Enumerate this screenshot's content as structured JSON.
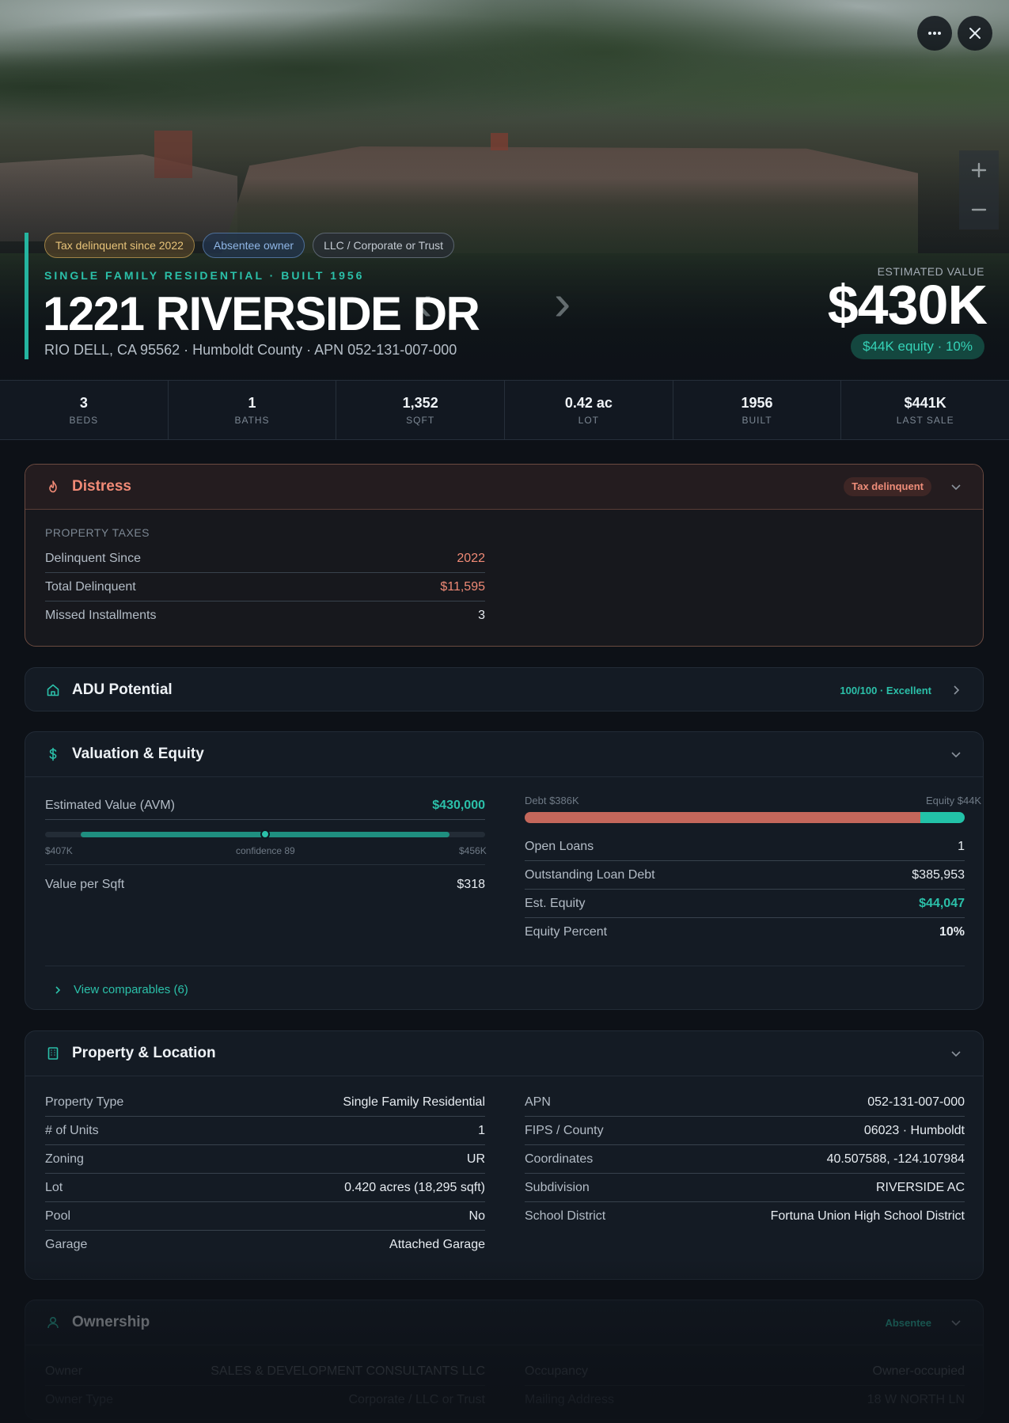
{
  "hero": {
    "badges": [
      "Tax delinquent since 2022",
      "Absentee owner",
      "LLC / Corporate or Trust"
    ],
    "eyebrow": "SINGLE FAMILY RESIDENTIAL · BUILT 1956",
    "address": "1221 RIVERSIDE DR",
    "subaddress": "RIO DELL, CA 95562 · Humboldt County · APN 052-131-007-000",
    "estimated_label": "ESTIMATED VALUE",
    "estimated_value": "$430K",
    "equity_pill": "$44K equity · 10%",
    "icons": {
      "more": "more-icon",
      "close": "close-icon",
      "zoom_in": "plus-icon",
      "zoom_out": "minus-icon"
    }
  },
  "stats": [
    {
      "value": "3",
      "label": "BEDS"
    },
    {
      "value": "1",
      "label": "BATHS"
    },
    {
      "value": "1,352",
      "label": "SQFT"
    },
    {
      "value": "0.42 ac",
      "label": "LOT"
    },
    {
      "value": "1956",
      "label": "BUILT"
    },
    {
      "value": "$441K",
      "label": "LAST SALE"
    }
  ],
  "distress": {
    "title": "Distress",
    "tag": "Tax delinquent",
    "section_label": "PROPERTY TAXES",
    "rows": [
      {
        "k": "Delinquent Since",
        "v": "2022"
      },
      {
        "k": "Total Delinquent",
        "v": "$11,595"
      },
      {
        "k": "Missed Installments",
        "v": "3"
      }
    ]
  },
  "adu": {
    "title": "ADU Potential",
    "score": "100/100 · Excellent"
  },
  "valuation": {
    "title": "Valuation & Equity",
    "avm_label": "Estimated Value (AVM)",
    "avm_value": "$430,000",
    "range_low": "$407K",
    "range_high": "$456K",
    "confidence": "confidence 89",
    "value_per_sqft_label": "Value per Sqft",
    "value_per_sqft": "$318",
    "debt_label": "Debt $386K",
    "equity_label": "Equity $44K",
    "equity_fraction": 0.1,
    "rows": [
      {
        "k": "Open Loans",
        "v": "1"
      },
      {
        "k": "Outstanding Loan Debt",
        "v": "$385,953"
      },
      {
        "k": "Est. Equity",
        "v": "$44,047"
      },
      {
        "k": "Equity Percent",
        "v": "10%"
      }
    ],
    "comparables_link": "View comparables (6)"
  },
  "property": {
    "title": "Property & Location",
    "left": [
      {
        "k": "Property Type",
        "v": "Single Family Residential"
      },
      {
        "k": "# of Units",
        "v": "1"
      },
      {
        "k": "Zoning",
        "v": "UR"
      },
      {
        "k": "Lot",
        "v": "0.420 acres (18,295 sqft)"
      },
      {
        "k": "Pool",
        "v": "No"
      },
      {
        "k": "Garage",
        "v": "Attached Garage"
      }
    ],
    "right": [
      {
        "k": "APN",
        "v": "052-131-007-000"
      },
      {
        "k": "FIPS / County",
        "v": "06023 · Humboldt"
      },
      {
        "k": "Coordinates",
        "v": "40.507588, -124.107984"
      },
      {
        "k": "Subdivision",
        "v": "RIVERSIDE AC"
      },
      {
        "k": "School District",
        "v": "Fortuna Union High School District"
      }
    ]
  },
  "ownership": {
    "title": "Ownership",
    "tag": "Absentee",
    "left": [
      {
        "k": "Owner",
        "v": "SALES & DEVELOPMENT CONSULTANTS LLC"
      },
      {
        "k": "Owner Type",
        "v": "Corporate / LLC or Trust"
      }
    ],
    "right": [
      {
        "k": "Occupancy",
        "v": "Owner-occupied"
      },
      {
        "k": "Mailing Address",
        "v": "18 W NORTH LN"
      }
    ]
  },
  "colors": {
    "accent": "#2bc0a9",
    "distress": "#f08a76",
    "debt": "#c4675b",
    "equity": "#22c2a8"
  }
}
